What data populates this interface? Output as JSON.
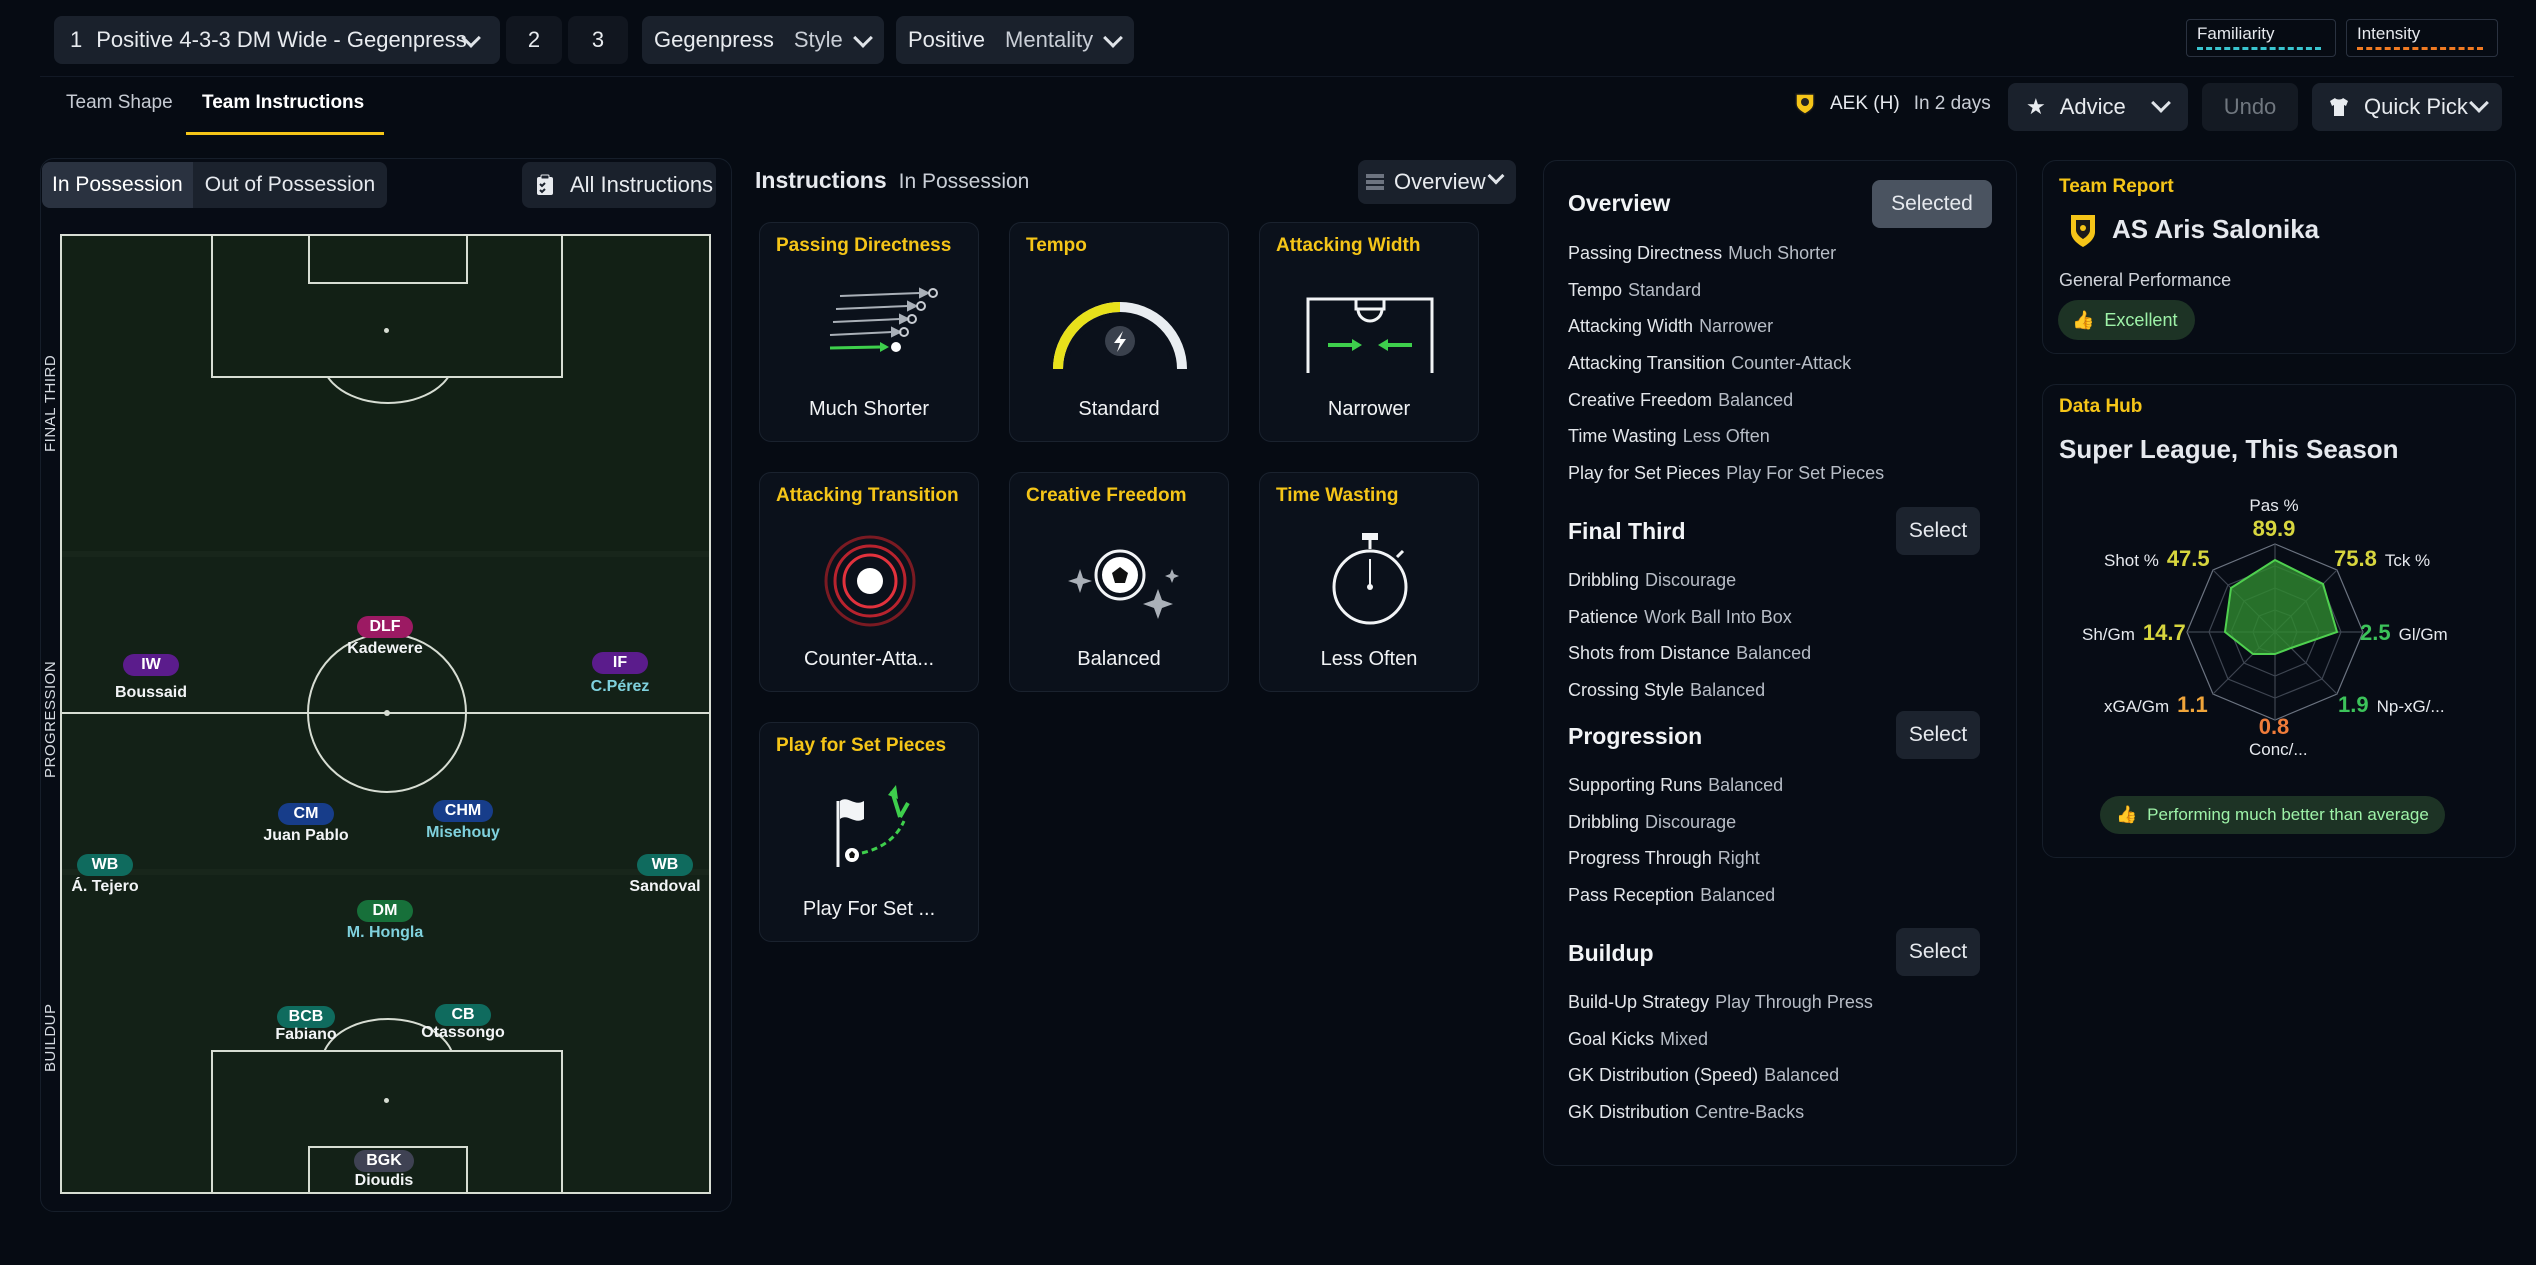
{
  "topbar": {
    "tactic_slot_1": "1",
    "tactic_name": "Positive 4-3-3 DM Wide - Gegenpress",
    "tactic_slot_2": "2",
    "tactic_slot_3": "3",
    "style_value": "Gegenpress",
    "style_label": "Style",
    "mentality_value": "Positive",
    "mentality_label": "Mentality",
    "familiarity_label": "Familiarity",
    "intensity_label": "Intensity"
  },
  "tabs": {
    "team_shape": "Team Shape",
    "team_instructions": "Team Instructions"
  },
  "match": {
    "opponent": "AEK (H)",
    "when": "In 2 days"
  },
  "actions": {
    "advice": "Advice",
    "undo": "Undo",
    "quick_pick": "Quick Pick"
  },
  "pitch_panel": {
    "in_possession": "In Possession",
    "out_of_possession": "Out of Possession",
    "all_instructions": "All Instructions",
    "zones": {
      "final_third": "FINAL THIRD",
      "progression": "PROGRESSION",
      "buildup": "BUILDUP"
    },
    "players": [
      {
        "pos": "DLF",
        "name": "Kadewere",
        "color": "#9c1a63"
      },
      {
        "pos": "IW",
        "name": "Boussaid",
        "color": "#5b1c8c"
      },
      {
        "pos": "IF",
        "name": "C.Pérez",
        "color": "#5b1c8c"
      },
      {
        "pos": "CM",
        "name": "Juan Pablo",
        "color": "#173d8a"
      },
      {
        "pos": "CHM",
        "name": "Misehouy",
        "color": "#173d8a"
      },
      {
        "pos": "WB",
        "name": "Á. Tejero",
        "color": "#0f6b5e"
      },
      {
        "pos": "WB",
        "name": "Sandoval",
        "color": "#0f6b5e"
      },
      {
        "pos": "DM",
        "name": "M. Hongla",
        "color": "#17703a"
      },
      {
        "pos": "BCB",
        "name": "Fabiano",
        "color": "#0f6b5e"
      },
      {
        "pos": "CB",
        "name": "Otassongo",
        "color": "#0f6b5e"
      },
      {
        "pos": "BGK",
        "name": "Dioudis",
        "color": "#3f4253"
      }
    ]
  },
  "instructions": {
    "title": "Instructions",
    "subtitle": "In Possession",
    "view": "Overview",
    "cards": [
      {
        "title": "Passing Directness",
        "value": "Much Shorter"
      },
      {
        "title": "Tempo",
        "value": "Standard"
      },
      {
        "title": "Attacking Width",
        "value": "Narrower"
      },
      {
        "title": "Attacking Transition",
        "value": "Counter-Atta..."
      },
      {
        "title": "Creative Freedom",
        "value": "Balanced"
      },
      {
        "title": "Time Wasting",
        "value": "Less Often"
      },
      {
        "title": "Play for Set Pieces",
        "value": "Play For Set ..."
      }
    ]
  },
  "overview": {
    "title": "Overview",
    "selected": "Selected",
    "select": "Select",
    "overview_rows": [
      {
        "k": "Passing Directness",
        "v": "Much Shorter"
      },
      {
        "k": "Tempo",
        "v": "Standard"
      },
      {
        "k": "Attacking Width",
        "v": "Narrower"
      },
      {
        "k": "Attacking Transition",
        "v": "Counter-Attack"
      },
      {
        "k": "Creative Freedom",
        "v": "Balanced"
      },
      {
        "k": "Time Wasting",
        "v": "Less Often"
      },
      {
        "k": "Play for Set Pieces",
        "v": "Play For Set Pieces"
      }
    ],
    "final_third_title": "Final Third",
    "final_third_rows": [
      {
        "k": "Dribbling",
        "v": "Discourage"
      },
      {
        "k": "Patience",
        "v": "Work Ball Into Box"
      },
      {
        "k": "Shots from Distance",
        "v": "Balanced"
      },
      {
        "k": "Crossing Style",
        "v": "Balanced"
      }
    ],
    "progression_title": "Progression",
    "progression_rows": [
      {
        "k": "Supporting Runs",
        "v": "Balanced"
      },
      {
        "k": "Dribbling",
        "v": "Discourage"
      },
      {
        "k": "Progress Through",
        "v": "Right"
      },
      {
        "k": "Pass Reception",
        "v": "Balanced"
      }
    ],
    "buildup_title": "Buildup",
    "buildup_rows": [
      {
        "k": "Build-Up Strategy",
        "v": "Play Through Press"
      },
      {
        "k": "Goal Kicks",
        "v": "Mixed"
      },
      {
        "k": "GK Distribution (Speed)",
        "v": "Balanced"
      },
      {
        "k": "GK Distribution",
        "v": "Centre-Backs"
      }
    ]
  },
  "team_report": {
    "label": "Team Report",
    "club": "AS Aris Salonika",
    "perf_label": "General Performance",
    "perf_value": "Excellent"
  },
  "data_hub": {
    "label": "Data Hub",
    "title": "Super League, This Season",
    "footer": "Performing much better than average",
    "stats": [
      {
        "label": "Pas %",
        "value": "89.9",
        "color": "#d7d63e"
      },
      {
        "label": "Tck %",
        "value": "75.8",
        "color": "#d7d63e"
      },
      {
        "label": "Gl/Gm",
        "value": "2.5",
        "color": "#3cc35a"
      },
      {
        "label": "Np-xG/...",
        "value": "1.9",
        "color": "#3cc35a"
      },
      {
        "label": "Conc/...",
        "value": "0.8",
        "color": "#f07c3a"
      },
      {
        "label": "xGA/Gm",
        "value": "1.1",
        "color": "#f0a53a"
      },
      {
        "label": "Sh/Gm",
        "value": "14.7",
        "color": "#d7d63e"
      },
      {
        "label": "Shot %",
        "value": "47.5",
        "color": "#d7d63e"
      }
    ]
  }
}
